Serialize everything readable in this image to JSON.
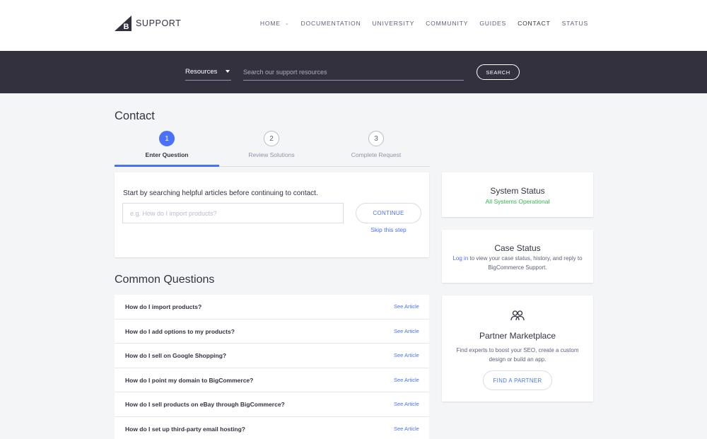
{
  "header": {
    "brand": "SUPPORT",
    "nav": [
      {
        "label": "HOME",
        "has_dropdown": true
      },
      {
        "label": "DOCUMENTATION"
      },
      {
        "label": "UNIVERSITY"
      },
      {
        "label": "COMMUNITY"
      },
      {
        "label": "GUIDES"
      },
      {
        "label": "CONTACT",
        "active": true
      },
      {
        "label": "STATUS"
      }
    ]
  },
  "search": {
    "resource_select": "Resources",
    "placeholder": "Search our support resources",
    "button": "SEARCH"
  },
  "contact": {
    "title": "Contact",
    "steps": [
      {
        "number": "1",
        "label": "Enter Question",
        "active": true
      },
      {
        "number": "2",
        "label": "Review Solutions"
      },
      {
        "number": "3",
        "label": "Complete Request"
      }
    ],
    "prompt": "Start by searching helpful articles before continuing to contact.",
    "input_placeholder": "e.g. How do I import products?",
    "continue_label": "CONTINUE",
    "skip_label": "Skip this step"
  },
  "common_questions": {
    "title": "Common Questions",
    "link_label": "See Article",
    "items": [
      "How do I import products?",
      "How do I add options to my products?",
      "How do I sell on Google Shopping?",
      "How do I point my domain to BigCommerce?",
      "How do I sell products on eBay through BigCommerce?",
      "How do I set up third-party email hosting?"
    ]
  },
  "system_status": {
    "title": "System Status",
    "status": "All Systems Operational"
  },
  "case_status": {
    "title": "Case Status",
    "login_link": "Log in",
    "text": " to view your case status, history, and reply to BigCommerce Support."
  },
  "partner": {
    "title": "Partner Marketplace",
    "text": "Find experts to boost your SEO, create a custom design or build an app.",
    "button": "FIND A PARTNER"
  },
  "colors": {
    "accent": "#4b71fc",
    "dark_band": "#34313f",
    "operational": "#2fb84b",
    "background": "#f4f5f7"
  },
  "icons": [
    "bigcommerce-logo-icon",
    "chevron-down-icon",
    "caret-down-icon",
    "people-icon"
  ]
}
